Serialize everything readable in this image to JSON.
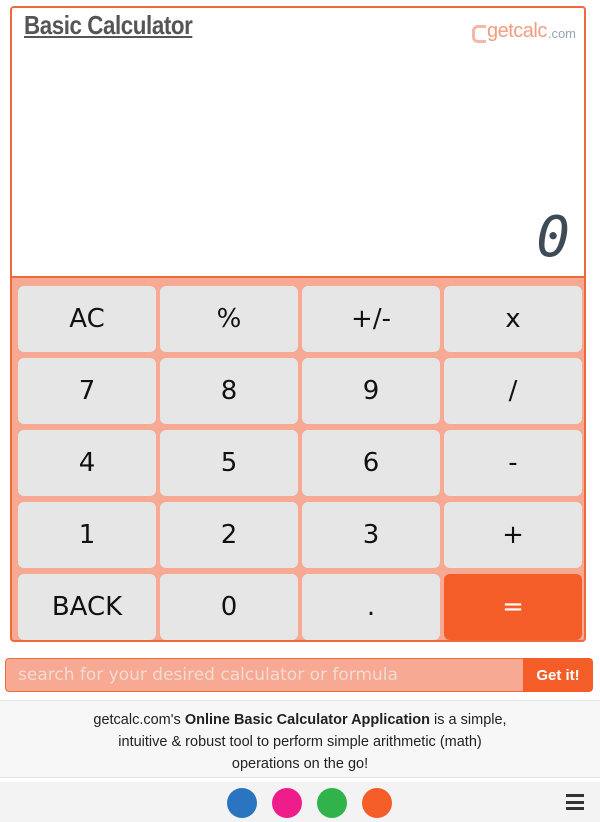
{
  "calculator": {
    "title": "Basic Calculator",
    "logo": {
      "word": "getcalc",
      "domain": ".com"
    },
    "display_value": "0",
    "keys": [
      {
        "label": "AC",
        "name": "key-ac"
      },
      {
        "label": "%",
        "name": "key-percent"
      },
      {
        "label": "+/-",
        "name": "key-plus-minus"
      },
      {
        "label": "x",
        "name": "key-multiply"
      },
      {
        "label": "7",
        "name": "key-7"
      },
      {
        "label": "8",
        "name": "key-8"
      },
      {
        "label": "9",
        "name": "key-9"
      },
      {
        "label": "/",
        "name": "key-divide"
      },
      {
        "label": "4",
        "name": "key-4"
      },
      {
        "label": "5",
        "name": "key-5"
      },
      {
        "label": "6",
        "name": "key-6"
      },
      {
        "label": "-",
        "name": "key-subtract"
      },
      {
        "label": "1",
        "name": "key-1"
      },
      {
        "label": "2",
        "name": "key-2"
      },
      {
        "label": "3",
        "name": "key-3"
      },
      {
        "label": "+",
        "name": "key-add"
      },
      {
        "label": "BACK",
        "name": "key-back"
      },
      {
        "label": "0",
        "name": "key-0"
      },
      {
        "label": ".",
        "name": "key-decimal"
      },
      {
        "label": "=",
        "name": "key-equals"
      }
    ]
  },
  "search": {
    "placeholder": "search for your desired calculator or formula",
    "button_label": "Get it!"
  },
  "description": {
    "part1": "getcalc.com's ",
    "bold": "Online Basic Calculator Application",
    "part2": " is a simple,",
    "line2": "intuitive & robust tool to perform simple arithmetic (math)",
    "line3": "operations on the go!"
  },
  "footer": {
    "theme_colors": [
      "#2a74c0",
      "#ee1d8a",
      "#2fb34a",
      "#f45d27"
    ]
  }
}
